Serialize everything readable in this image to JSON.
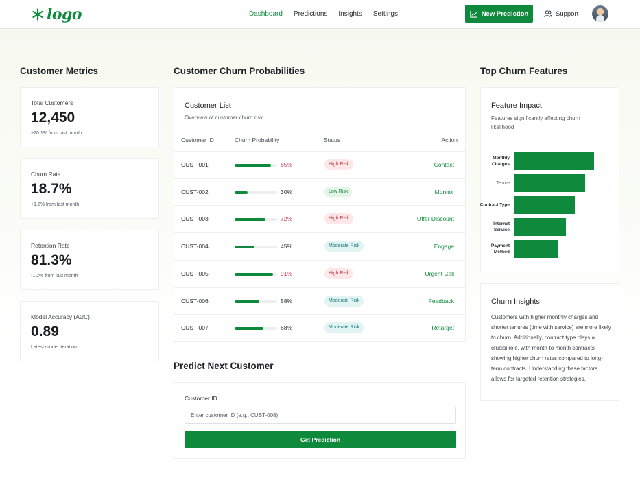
{
  "header": {
    "logo_text": "logo",
    "nav": [
      {
        "label": "Dashboard",
        "active": true
      },
      {
        "label": "Predictions",
        "active": false
      },
      {
        "label": "Insights",
        "active": false
      },
      {
        "label": "Settings",
        "active": false
      }
    ],
    "new_prediction_label": "New Prediction",
    "support_label": "Support",
    "icons": {
      "logo": "leaf-sparkle-icon",
      "chart": "chart-line-icon",
      "support": "users-icon"
    }
  },
  "colors": {
    "accent": "#0f8a3c",
    "high_risk_bg": "#fde7e8",
    "high_risk_text": "#c8323c",
    "low_risk_bg": "#e2f5e7",
    "low_risk_text": "#1b7a3c",
    "moderate_bg": "#e2f3f3",
    "moderate_text": "#1d7d7d"
  },
  "metrics_section": {
    "title": "Customer Metrics",
    "cards": [
      {
        "label": "Total Customers",
        "value": "12,450",
        "sub": "+20.1% from last month"
      },
      {
        "label": "Churn Rate",
        "value": "18.7%",
        "sub": "+1.2% from last month"
      },
      {
        "label": "Retention Rate",
        "value": "81.3%",
        "sub": "-1.2% from last month"
      },
      {
        "label": "Model Accuracy (AUC)",
        "value": "0.89",
        "sub": "Latest model iteration"
      }
    ]
  },
  "churn_section": {
    "title": "Customer Churn Probabilities",
    "list_title": "Customer List",
    "list_subtitle": "Overview of customer churn risk",
    "columns": [
      "Customer ID",
      "Churn Probability",
      "Status",
      "Action"
    ],
    "rows": [
      {
        "id": "CUST-001",
        "prob_text": "85%",
        "prob": 85,
        "status": "High Risk",
        "level": "high",
        "action": "Contact"
      },
      {
        "id": "CUST-002",
        "prob_text": "30%",
        "prob": 30,
        "status": "Low Risk",
        "level": "low",
        "action": "Monitor"
      },
      {
        "id": "CUST-003",
        "prob_text": "72%",
        "prob": 72,
        "status": "High Risk",
        "level": "high",
        "action": "Offer Discount"
      },
      {
        "id": "CUST-004",
        "prob_text": "45%",
        "prob": 45,
        "status": "Moderate Risk",
        "level": "moderate",
        "action": "Engage"
      },
      {
        "id": "CUST-005",
        "prob_text": "91%",
        "prob": 91,
        "status": "High Risk",
        "level": "high",
        "action": "Urgent Call"
      },
      {
        "id": "CUST-006",
        "prob_text": "58%",
        "prob": 58,
        "status": "Moderate Risk",
        "level": "moderate",
        "action": "Feedback"
      },
      {
        "id": "CUST-007",
        "prob_text": "68%",
        "prob": 68,
        "status": "Moderate Risk",
        "level": "moderate",
        "action": "Retarget"
      }
    ]
  },
  "predict_section": {
    "title": "Predict Next Customer",
    "field_label": "Customer ID",
    "placeholder": "Enter customer ID (e.g., CUST-008)",
    "button_label": "Get Prediction"
  },
  "features_section": {
    "title": "Top Churn Features",
    "card_title": "Feature Impact",
    "card_subtitle": "Features significantly affecting churn likelihood",
    "features": [
      {
        "label": "Monthly Charges",
        "impact": 100
      },
      {
        "label": "Tenure",
        "impact": 89
      },
      {
        "label": "Contract Type",
        "impact": 76
      },
      {
        "label": "Internet Service",
        "impact": 65
      },
      {
        "label": "Payment Method",
        "impact": 54
      }
    ]
  },
  "insights": {
    "title": "Churn Insights",
    "text": "Customers with higher monthly charges and shorter tenures (time with service) are more likely to churn. Additionally, contract type plays a crucial role, with month-to-month contracts showing higher churn rates compared to long-term contracts. Understanding these factors allows for targeted retention strategies."
  }
}
